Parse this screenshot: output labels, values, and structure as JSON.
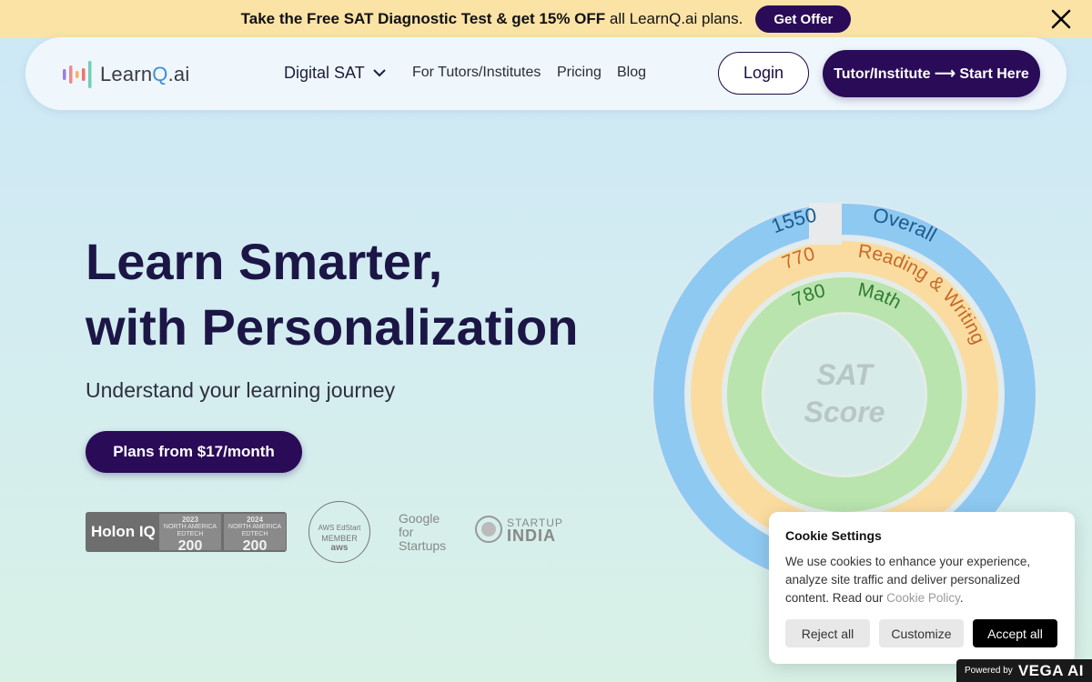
{
  "promo": {
    "text_bold": "Take the Free SAT Diagnostic Test & get 15% OFF",
    "text_rest": " all LearnQ.ai plans.",
    "button": "Get Offer"
  },
  "nav": {
    "logo_learn": "Learn",
    "logo_q": "Q",
    "logo_ai": ".ai",
    "digital_sat": "Digital SAT",
    "tutors": "For Tutors/Institutes",
    "pricing": "Pricing",
    "blog": "Blog",
    "login": "Login",
    "tutor_cta": "Tutor/Institute ⟶ Start Here"
  },
  "hero": {
    "title_line1": "Learn Smarter,",
    "title_line2": "with Personalization",
    "subtitle": "Understand your learning journey",
    "cta": "Plans from $17/month"
  },
  "badges": {
    "holon": "Holon IQ",
    "holon_cells": [
      {
        "year": "2023",
        "line1": "NORTH AMERICA",
        "line2": "EDTECH",
        "num": "200"
      },
      {
        "year": "2024",
        "line1": "NORTH AMERICA",
        "line2": "EDTECH",
        "num": "200"
      }
    ],
    "aws_top": "AWS EdStart",
    "aws_mid": "MEMBER",
    "aws_bot": "aws",
    "google_1": "Google",
    "google_2": "for",
    "google_3": "Startups",
    "startup_1": "STARTUP",
    "startup_2": "INDIA"
  },
  "sat": {
    "overall_label": "Overall",
    "overall_score": "1550",
    "rw_label": "Reading & Writing",
    "rw_score": "770",
    "math_label": "Math",
    "math_score": "780",
    "center_1": "SAT",
    "center_2": "Score",
    "colors": {
      "overall": "#8ec9f2",
      "rw": "#fbdca0",
      "math": "#b9e4ad"
    }
  },
  "cookie": {
    "title": "Cookie Settings",
    "body": "We use cookies to enhance your experience, analyze site traffic and deliver personalized content. Read our ",
    "link": "Cookie Policy",
    "end": ".",
    "reject": "Reject all",
    "customize": "Customize",
    "accept": "Accept all"
  },
  "powered": {
    "label": "Powered by",
    "brand": "VEGA AI"
  }
}
